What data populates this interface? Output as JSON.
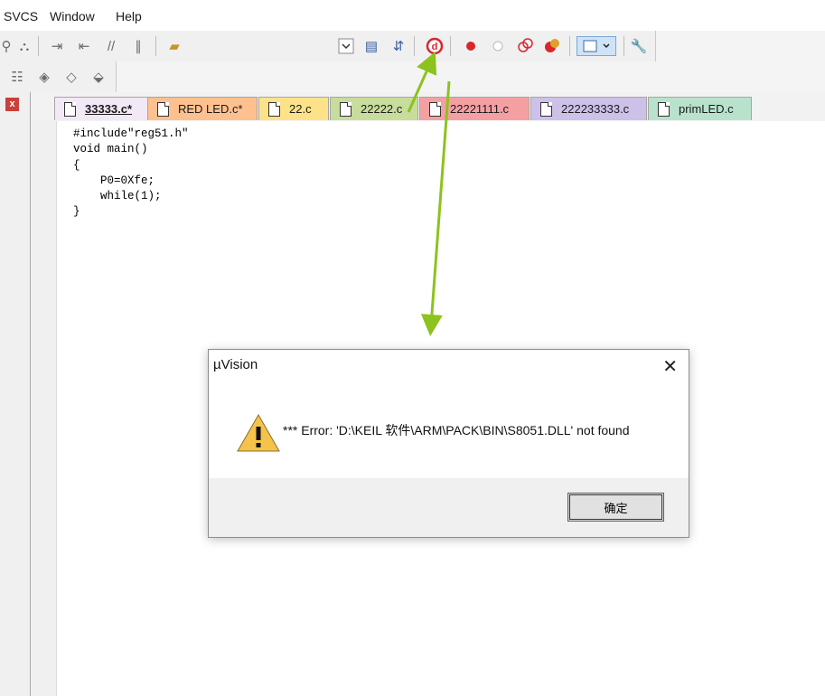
{
  "menu": {
    "items": [
      "SVCS",
      "Window",
      "Help"
    ]
  },
  "tabs": [
    {
      "label": "33333.c*",
      "color": "#f3e8f5",
      "active": true
    },
    {
      "label": "RED LED.c*",
      "color": "#ffc08f"
    },
    {
      "label": "22.c",
      "color": "#fde28a"
    },
    {
      "label": "22222.c",
      "color": "#c8dd9c"
    },
    {
      "label": "22221111.c",
      "color": "#f4a0a3"
    },
    {
      "label": "222233333.c",
      "color": "#cdc1ea"
    },
    {
      "label": "primLED.c",
      "color": "#b8e2cc"
    }
  ],
  "editor": {
    "lines": [
      "#include\"reg51.h\"",
      "void main()",
      "{",
      "    P0=0Xfe;",
      "    while(1);",
      "}"
    ]
  },
  "dialog": {
    "title": "µVision",
    "close_glyph": "✕",
    "message": "*** Error: 'D:\\KEIL 软件\\ARM\\PACK\\BIN\\S8051.DLL' not found",
    "ok_label": "确定"
  },
  "leftpane": {
    "close_glyph": "x"
  },
  "colors": {
    "arrow": "#8dc21f",
    "debug_red": "#d9262c"
  }
}
